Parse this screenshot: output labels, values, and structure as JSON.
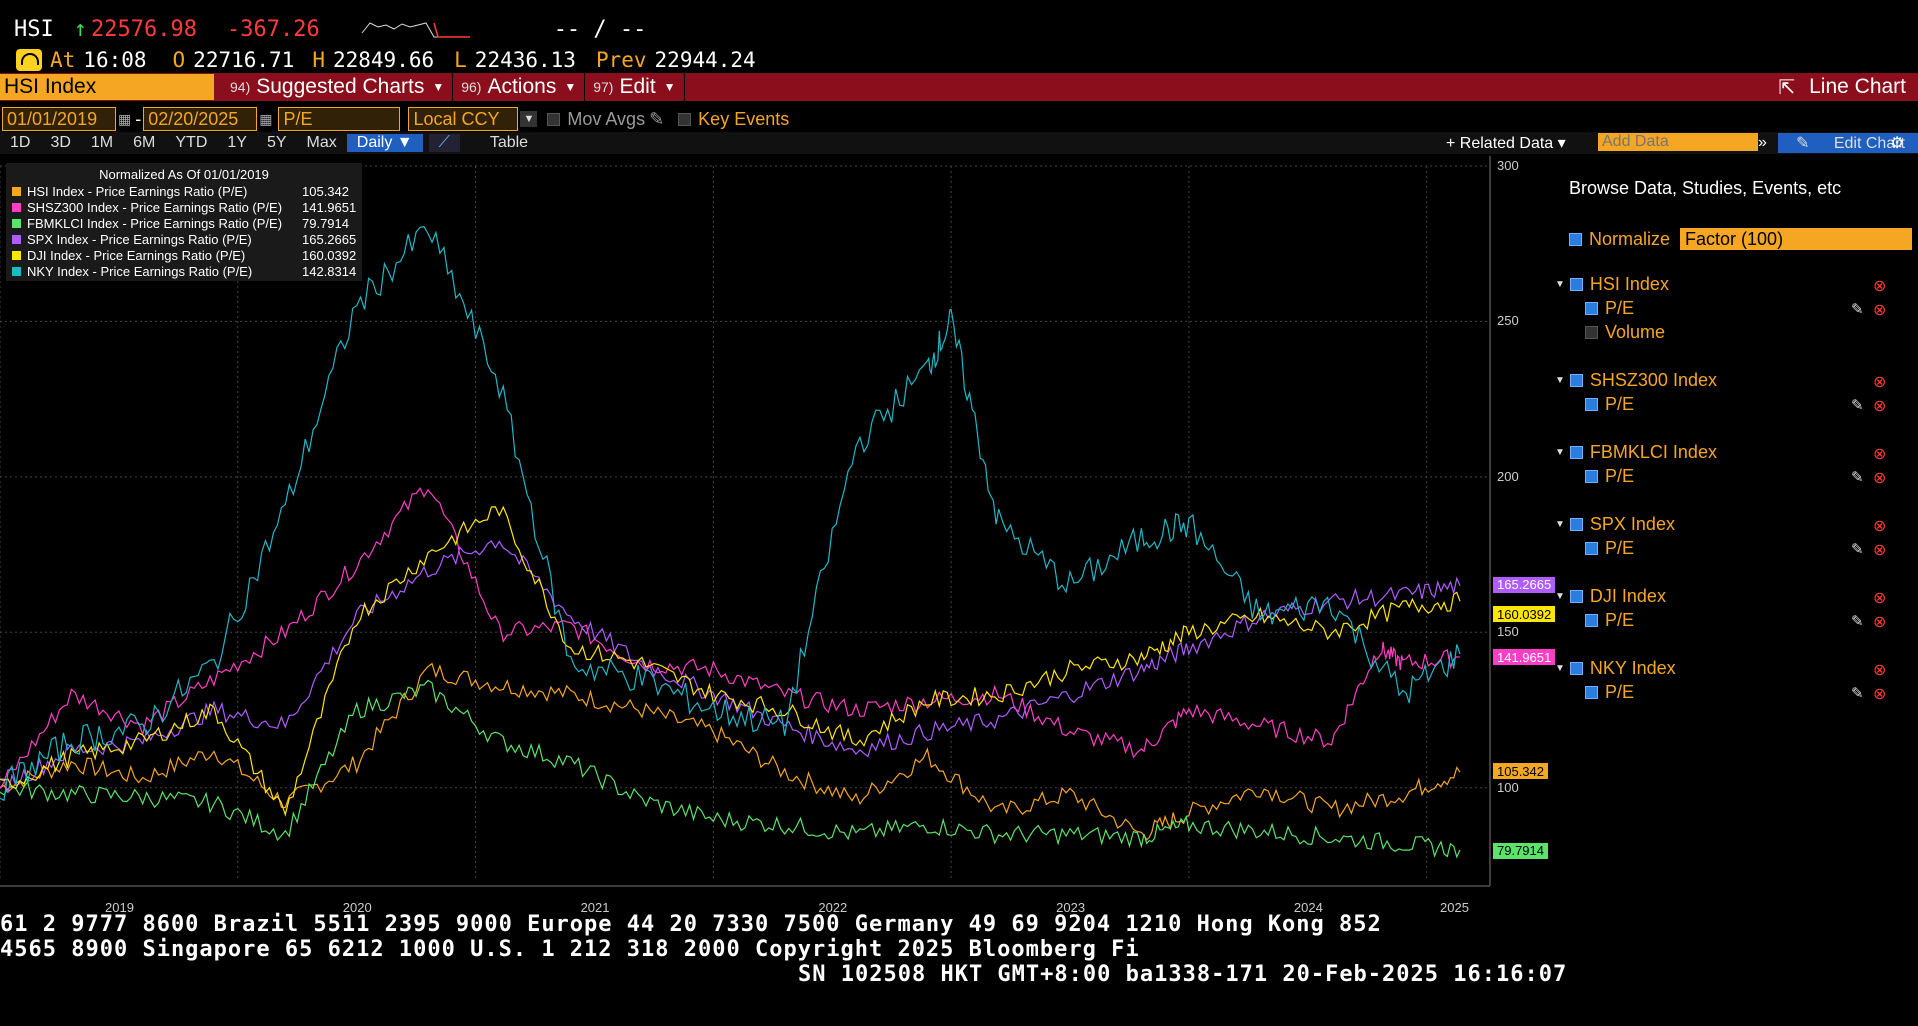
{
  "header": {
    "ticker": "HSI",
    "arrow": "↑",
    "last": "22576.98",
    "change": "-367.26",
    "time_range": "-- / --",
    "at_label": "At",
    "at_time": "16:08",
    "open_label": "O",
    "open": "22716.71",
    "high_label": "H",
    "high": "22849.66",
    "low_label": "L",
    "low": "22436.13",
    "prev_label": "Prev",
    "prev": "22944.24"
  },
  "menu": {
    "security": "HSI Index",
    "suggested_num": "94)",
    "suggested": "Suggested Charts",
    "actions_num": "96)",
    "actions": "Actions",
    "edit_num": "97)",
    "edit": "Edit",
    "line_chart": "Line Chart"
  },
  "filters": {
    "start_date": "01/01/2019",
    "sep": "-",
    "end_date": "02/20/2025",
    "field": "P/E",
    "currency": "Local CCY",
    "mov_avgs": "Mov Avgs",
    "key_events": "Key Events"
  },
  "timeframes": {
    "items": [
      "1D",
      "3D",
      "1M",
      "6M",
      "YTD",
      "1Y",
      "5Y",
      "Max"
    ],
    "period": "Daily ▼",
    "table": "Table",
    "related": "+ Related Data ▾",
    "add_data_placeholder": "Add Data",
    "edit_chart": "Edit Chart"
  },
  "sidebar": {
    "browse": "Browse Data, Studies, Events, etc",
    "normalize": "Normalize",
    "factor": "Factor (100)",
    "groups": [
      {
        "name": "HSI Index",
        "items": [
          "P/E",
          "Volume"
        ]
      },
      {
        "name": "SHSZ300 Index",
        "items": [
          "P/E"
        ]
      },
      {
        "name": "FBMKLCI Index",
        "items": [
          "P/E"
        ]
      },
      {
        "name": "SPX Index",
        "items": [
          "P/E"
        ]
      },
      {
        "name": "DJI Index",
        "items": [
          "P/E"
        ]
      },
      {
        "name": "NKY Index",
        "items": [
          "P/E"
        ]
      }
    ]
  },
  "chart_data": {
    "type": "line",
    "legend_title": "Normalized As Of 01/01/2019",
    "legend_placement": "top-left",
    "ylim": [
      70,
      300
    ],
    "yticks": [
      100,
      150,
      200,
      250,
      300
    ],
    "xticks": [
      "2019",
      "2020",
      "2021",
      "2022",
      "2023",
      "2024",
      "2025"
    ],
    "x_range": [
      2019.0,
      2025.14
    ],
    "grid": true,
    "series": [
      {
        "name": "HSI Index - Price Earnings Ratio (P/E)",
        "last": "105.342",
        "color": "#f5a623",
        "x": [
          2019.0,
          2019.3,
          2019.6,
          2019.9,
          2020.2,
          2020.5,
          2020.8,
          2021.1,
          2021.4,
          2021.7,
          2022.0,
          2022.3,
          2022.6,
          2022.9,
          2023.2,
          2023.5,
          2023.8,
          2024.0,
          2024.3,
          2024.6,
          2024.9,
          2025.14
        ],
        "y": [
          100,
          108,
          103,
          112,
          95,
          108,
          138,
          133,
          130,
          125,
          118,
          105,
          96,
          110,
          92,
          98,
          85,
          92,
          100,
          93,
          98,
          105
        ]
      },
      {
        "name": "SHSZ300 Index - Price Earnings Ratio (P/E)",
        "last": "141.9651",
        "color": "#ff3ec8",
        "x": [
          2019.0,
          2019.3,
          2019.6,
          2019.9,
          2020.2,
          2020.5,
          2020.8,
          2021.1,
          2021.4,
          2021.7,
          2022.0,
          2022.3,
          2022.6,
          2022.9,
          2023.2,
          2023.5,
          2023.8,
          2024.0,
          2024.3,
          2024.6,
          2024.8,
          2024.9,
          2025.14
        ],
        "y": [
          100,
          130,
          120,
          135,
          150,
          172,
          198,
          150,
          152,
          140,
          138,
          130,
          125,
          128,
          130,
          118,
          112,
          125,
          120,
          115,
          145,
          140,
          142
        ]
      },
      {
        "name": "FBMKLCI Index - Price Earnings Ratio (P/E)",
        "last": "79.7914",
        "color": "#5be36a",
        "x": [
          2019.0,
          2019.3,
          2019.6,
          2019.9,
          2020.2,
          2020.5,
          2020.8,
          2021.1,
          2021.4,
          2021.7,
          2022.0,
          2022.3,
          2022.6,
          2022.9,
          2023.2,
          2023.5,
          2023.8,
          2024.0,
          2024.3,
          2024.6,
          2024.9,
          2025.14
        ],
        "y": [
          100,
          98,
          97,
          95,
          85,
          125,
          132,
          115,
          108,
          96,
          90,
          88,
          85,
          88,
          85,
          85,
          84,
          88,
          86,
          84,
          82,
          80
        ]
      },
      {
        "name": "SPX Index - Price Earnings Ratio (P/E)",
        "last": "165.2665",
        "color": "#b05cff",
        "x": [
          2019.0,
          2019.3,
          2019.6,
          2019.9,
          2020.2,
          2020.5,
          2020.8,
          2021.1,
          2021.4,
          2021.7,
          2022.0,
          2022.3,
          2022.6,
          2022.9,
          2023.2,
          2023.5,
          2023.8,
          2024.0,
          2024.3,
          2024.6,
          2024.9,
          2025.14
        ],
        "y": [
          100,
          112,
          115,
          125,
          120,
          155,
          170,
          180,
          155,
          140,
          130,
          120,
          112,
          118,
          122,
          130,
          138,
          145,
          155,
          160,
          162,
          165
        ]
      },
      {
        "name": "DJI Index - Price Earnings Ratio (P/E)",
        "last": "160.0392",
        "color": "#ffe600",
        "x": [
          2019.0,
          2019.3,
          2019.6,
          2019.9,
          2020.2,
          2020.5,
          2020.8,
          2021.1,
          2021.4,
          2021.7,
          2022.0,
          2022.3,
          2022.6,
          2022.9,
          2023.2,
          2023.5,
          2023.8,
          2024.0,
          2024.3,
          2024.6,
          2024.9,
          2025.14
        ],
        "y": [
          100,
          110,
          115,
          125,
          92,
          155,
          175,
          190,
          145,
          140,
          130,
          125,
          115,
          128,
          130,
          138,
          142,
          150,
          155,
          150,
          158,
          160
        ]
      },
      {
        "name": "NKY Index - Price Earnings Ratio (P/E)",
        "last": "142.8314",
        "color": "#1fb8c8",
        "x": [
          2019.0,
          2019.3,
          2019.6,
          2019.9,
          2020.2,
          2020.5,
          2020.8,
          2021.1,
          2021.4,
          2021.7,
          2022.0,
          2022.3,
          2022.6,
          2022.9,
          2023.0,
          2023.2,
          2023.5,
          2023.8,
          2024.0,
          2024.3,
          2024.6,
          2024.9,
          2025.14
        ],
        "y": [
          100,
          115,
          120,
          140,
          190,
          255,
          280,
          230,
          140,
          135,
          125,
          120,
          210,
          235,
          250,
          185,
          165,
          180,
          185,
          155,
          160,
          130,
          143
        ]
      }
    ]
  },
  "ticker_tape": {
    "line1": "61 2 9777 8600 Brazil 5511 2395 9000 Europe 44 20 7330 7500 Germany 49 69 9204 1210 Hong Kong 852",
    "line2": " 4565 8900      Singapore 65 6212 1000      U.S. 1 212 318 2000        Copyright 2025 Bloomberg Fi",
    "line3": "SN 102508 HKT  GMT+8:00 ba1338-171 20-Feb-2025 16:16:07"
  }
}
